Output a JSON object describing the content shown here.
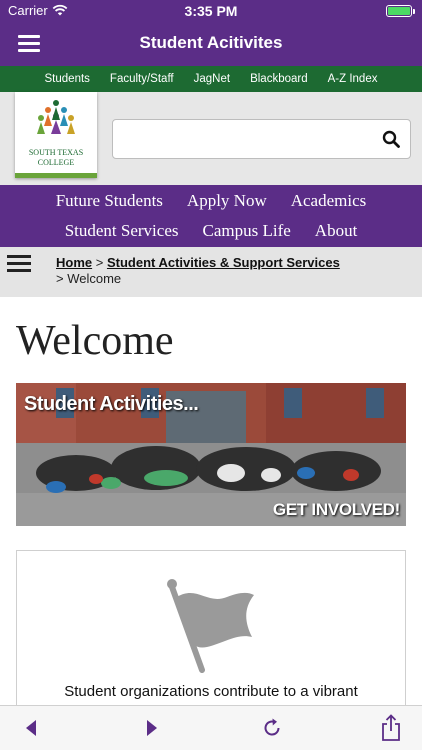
{
  "status_bar": {
    "carrier": "Carrier",
    "time": "3:35 PM"
  },
  "nav_bar": {
    "title": "Student Acitivites"
  },
  "utility_links": [
    "Students",
    "Faculty/Staff",
    "JagNet",
    "Blackboard",
    "A-Z Index"
  ],
  "logo": {
    "line1": "SOUTH TEXAS",
    "line2": "COLLEGE"
  },
  "search": {
    "value": "",
    "placeholder": ""
  },
  "main_nav": {
    "row1": [
      "Future Students",
      "Apply Now",
      "Academics"
    ],
    "row2": [
      "Student Services",
      "Campus Life",
      "About"
    ]
  },
  "breadcrumb": {
    "home": "Home",
    "sep1": " > ",
    "section": "Student Activities & Support Services",
    "current": "> Welcome"
  },
  "page": {
    "title": "Welcome",
    "banner_title": "Student Activities...",
    "banner_cta": "GET INVOLVED!",
    "card_text": "Student organizations contribute to a vibrant"
  },
  "colors": {
    "purple": "#5b2d87",
    "green": "#1d6a32",
    "toolbar_icon": "#5b2d87"
  },
  "toolbar_icons": [
    "back-arrow-icon",
    "forward-arrow-icon",
    "reload-icon",
    "share-icon"
  ]
}
